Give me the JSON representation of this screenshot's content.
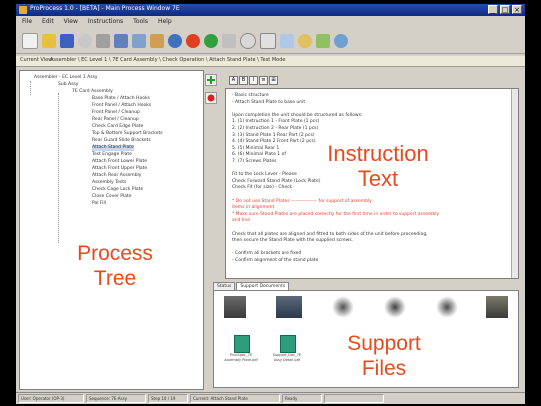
{
  "window": {
    "title": "ProProcess 1.0 - [BETA] - Main Process Window 7E",
    "buttons": [
      "_",
      "□",
      "×"
    ]
  },
  "menu": [
    "File",
    "Edit",
    "View",
    "Instructions",
    "Tools",
    "Help"
  ],
  "address": {
    "label": "Current View:",
    "path": "Assembler \\ EC Level 1 \\ 7E Card Assembly \\ Check Operation \\ Attach Stand Plate \\ Test Mode"
  },
  "tree": {
    "nodes": [
      "Assembler - EC Level 1 Assy",
      "Sub Assy",
      "7E Card Assembly",
      "Base Plate / Attach Hooks",
      "Front Panel / Attach Hooks",
      "Front Panel / Cleanup",
      "Rear Panel / Cleanup",
      "Check Card Edge Plate",
      "Top & Bottom Support Brackets",
      "Rear Guard Slide Brackets",
      "Attach Stand Plate",
      "Test Engage Plate",
      "Attach Front Lower Plate",
      "Attach Front Upper Plate",
      "Attach Rear Assembly",
      "Assembly Tests",
      "Check Cage Lock Plate",
      "Close Cover Plate",
      "Pal Fill"
    ],
    "big_label": [
      "Process",
      "Tree"
    ]
  },
  "instructions": {
    "toolbar": [
      "A",
      "B",
      "I",
      "≡",
      "⊞"
    ],
    "lines": [
      {
        "text": "- Basic structure",
        "red": false
      },
      {
        "text": "- Attach Stand Plate to base unit",
        "red": false
      },
      {
        "text": "",
        "red": false
      },
      {
        "text": "Upon completion the unit should be structured as follows:",
        "red": false
      },
      {
        "text": "1.  (1) Instruction 1 - Front Plate (1 pcs)",
        "red": false
      },
      {
        "text": "2.  (2) Instruction 2 - Rear Plate (1 pcs)",
        "red": false
      },
      {
        "text": "3.  (3) Stand Plate 1 Rear Part (2 pcs)",
        "red": false
      },
      {
        "text": "4.  (4) Stand Plate 2 Front Part (2 pcs)",
        "red": false
      },
      {
        "text": "5.  (5) Minimal Rear 1",
        "red": false
      },
      {
        "text": "6.  (6) Minimal Plate 1 of",
        "red": false
      },
      {
        "text": "7.  (7) Screws Plates",
        "red": false
      },
      {
        "text": "",
        "red": false
      },
      {
        "text": "Fit to the Lock Lever - Please",
        "red": false
      },
      {
        "text": "Check Forward Stand Plate (Lock Plate)",
        "red": false
      },
      {
        "text": "Check Fit (for size) - Check",
        "red": false
      },
      {
        "text": "",
        "red": false
      },
      {
        "text": "* Do not use Stand Plates ---------------- for support of assembly",
        "red": true
      },
      {
        "text": "items in alignment",
        "red": true
      },
      {
        "text": "* Make sure Stand Plates are placed correctly for the first time in order to support assembly",
        "red": true
      },
      {
        "text": "and line",
        "red": true
      },
      {
        "text": "",
        "red": false
      },
      {
        "text": "Check that all plates are aligned and fitted to both sides of the unit before proceeding,",
        "red": false
      },
      {
        "text": "then secure the Stand Plate with the supplied screws.",
        "red": false
      },
      {
        "text": "",
        "red": false
      },
      {
        "text": "- Confirm all brackets are fixed",
        "red": false
      },
      {
        "text": "- Confirm alignment of the stand plate",
        "red": false
      }
    ],
    "big_label": [
      "Instruction",
      "Text"
    ]
  },
  "support": {
    "tabs": [
      "Status",
      "Support Documents"
    ],
    "thumbs": [
      {
        "name": "photo-1"
      },
      {
        "name": "photo-2"
      },
      {
        "name": "photo-3"
      },
      {
        "name": "photo-4"
      },
      {
        "name": "photo-5"
      },
      {
        "name": "photo-6"
      }
    ],
    "files": [
      {
        "caption": "ProcSpec_7E Assembly Plate.pdf"
      },
      {
        "caption": "Support_Doc_7E Assy Detail.pdf"
      }
    ],
    "big_label": [
      "Support",
      "Files"
    ]
  },
  "status": [
    "User: Operator (OP-3)",
    "Sequence: 7E-Assy",
    "Step 10 / 19",
    "Current: Attach Stand Plate",
    "Ready",
    ""
  ],
  "colors": {
    "accent_label": "#e84a1e",
    "title_bar": "#0b2a86",
    "file_icon": "#2e9e7a"
  }
}
